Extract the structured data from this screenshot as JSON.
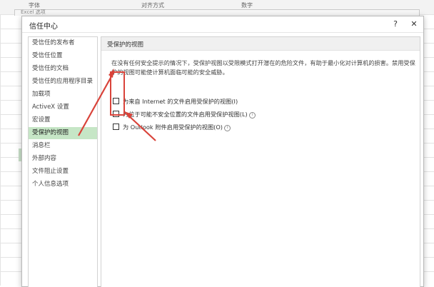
{
  "background": {
    "ribbon_labels": [
      "字体",
      "对齐方式",
      "数字"
    ],
    "under_dialog_title": "Excel 选项"
  },
  "dialog": {
    "title": "信任中心",
    "help_label": "?",
    "close_label": "✕"
  },
  "sidebar": {
    "items": [
      {
        "label": "受信任的发布者"
      },
      {
        "label": "受信任位置"
      },
      {
        "label": "受信任的文档"
      },
      {
        "label": "受信任的应用程序目录"
      },
      {
        "label": "加载项"
      },
      {
        "label": "ActiveX 设置"
      },
      {
        "label": "宏设置"
      },
      {
        "label": "受保护的视图"
      },
      {
        "label": "消息栏"
      },
      {
        "label": "外部内容"
      },
      {
        "label": "文件阻止设置"
      },
      {
        "label": "个人信息选项"
      }
    ],
    "active_index": 7
  },
  "content": {
    "section_title": "受保护的视图",
    "description": "在没有任何安全提示的情况下，受保护视图以受限模式打开潜在的危险文件，有助于最小化对计算机的损害。禁用受保护的视图可能使计算机面临可能的安全威胁。",
    "options": [
      {
        "label": "为来自 Internet 的文件启用受保护的视图(I)",
        "checked": false,
        "has_info": false
      },
      {
        "label": "为位于可能不安全位置的文件启用受保护视图(L)",
        "checked": false,
        "has_info": true
      },
      {
        "label": "为 Outlook 附件启用受保护的视图(O)",
        "checked": false,
        "has_info": true
      }
    ]
  },
  "colors": {
    "active_nav": "#c6e6c6",
    "annotation_red": "#d9433a"
  }
}
